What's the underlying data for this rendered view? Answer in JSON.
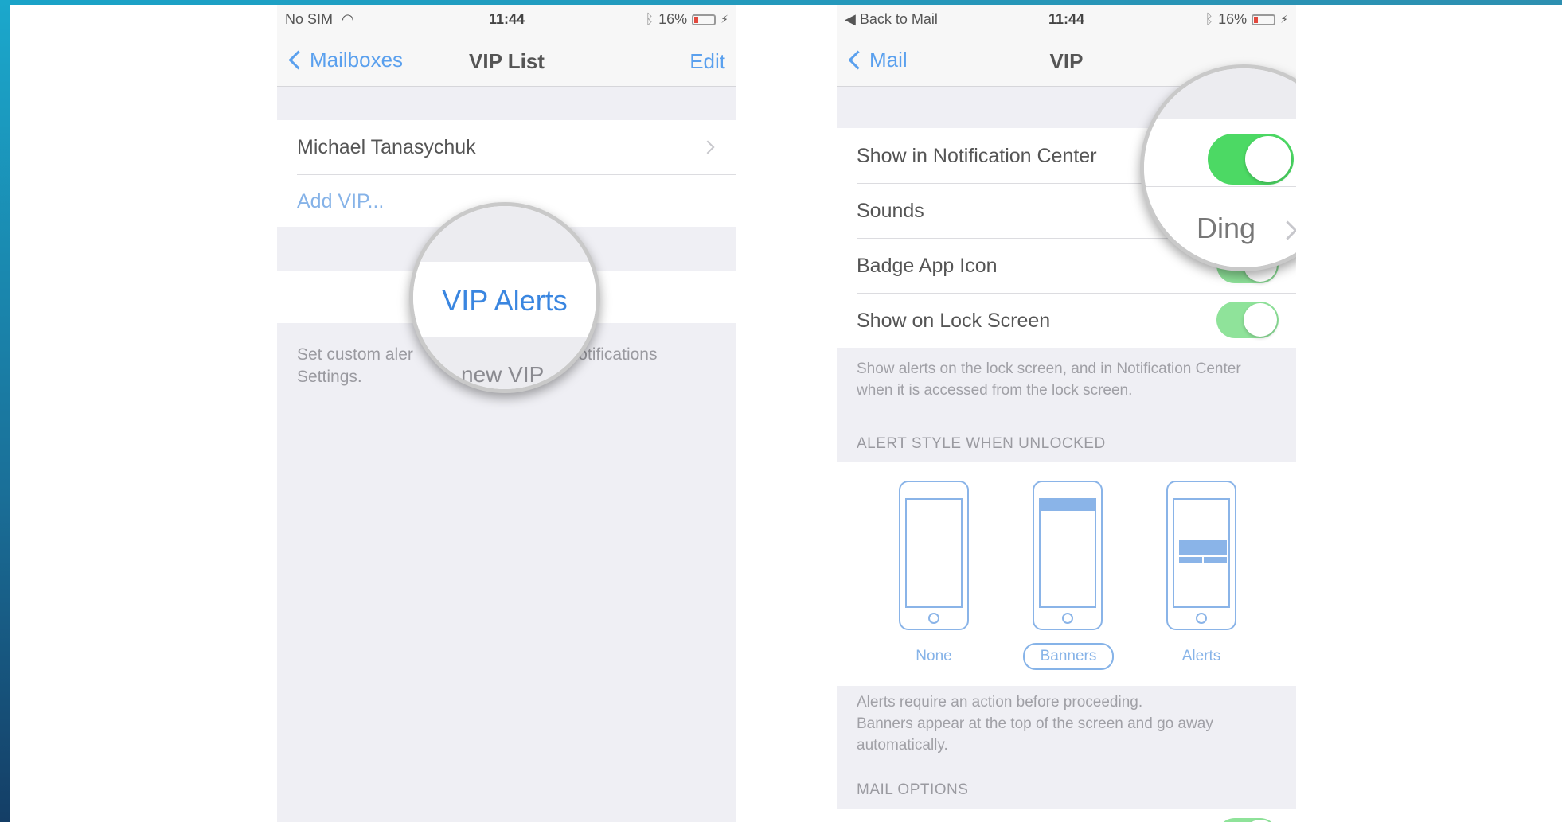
{
  "colors": {
    "accent": "#5aa0ee",
    "toggle_on": "#4cd964",
    "battery_low": "#e2483d"
  },
  "left": {
    "status": {
      "carrier": "No SIM",
      "time": "11:44",
      "battery": "16%"
    },
    "nav": {
      "back": "Mailboxes",
      "title": "VIP List",
      "right": "Edit"
    },
    "vip_name": "Michael Tanasychuk",
    "add_vip": "Add VIP...",
    "vip_alerts": "VIP Alerts",
    "footer_line1_a": "Set custom aler",
    "footer_line1_b": "in Notifications",
    "footer_line2": "Settings.",
    "footer_hidden": "new VIP"
  },
  "right": {
    "status": {
      "back_app": "Back to Mail",
      "time": "11:44",
      "battery": "16%"
    },
    "nav": {
      "back": "Mail",
      "title": "VIP"
    },
    "rows": {
      "show_nc": "Show in Notification Center",
      "sounds": "Sounds",
      "sounds_value": "Ding",
      "badge": "Badge App Icon",
      "lock": "Show on Lock Screen"
    },
    "toggles": {
      "show_nc": true,
      "badge": true,
      "lock": true
    },
    "lock_footer": "Show alerts on the lock screen, and in Notification Center when it is accessed from the lock screen.",
    "alert_header": "ALERT STYLE WHEN UNLOCKED",
    "alert_styles": [
      "None",
      "Banners",
      "Alerts"
    ],
    "alert_selected": "Banners",
    "alert_footer1": "Alerts require an action before proceeding.",
    "alert_footer2": "Banners appear at the top of the screen and go away automatically.",
    "mail_options": "MAIL OPTIONS"
  }
}
